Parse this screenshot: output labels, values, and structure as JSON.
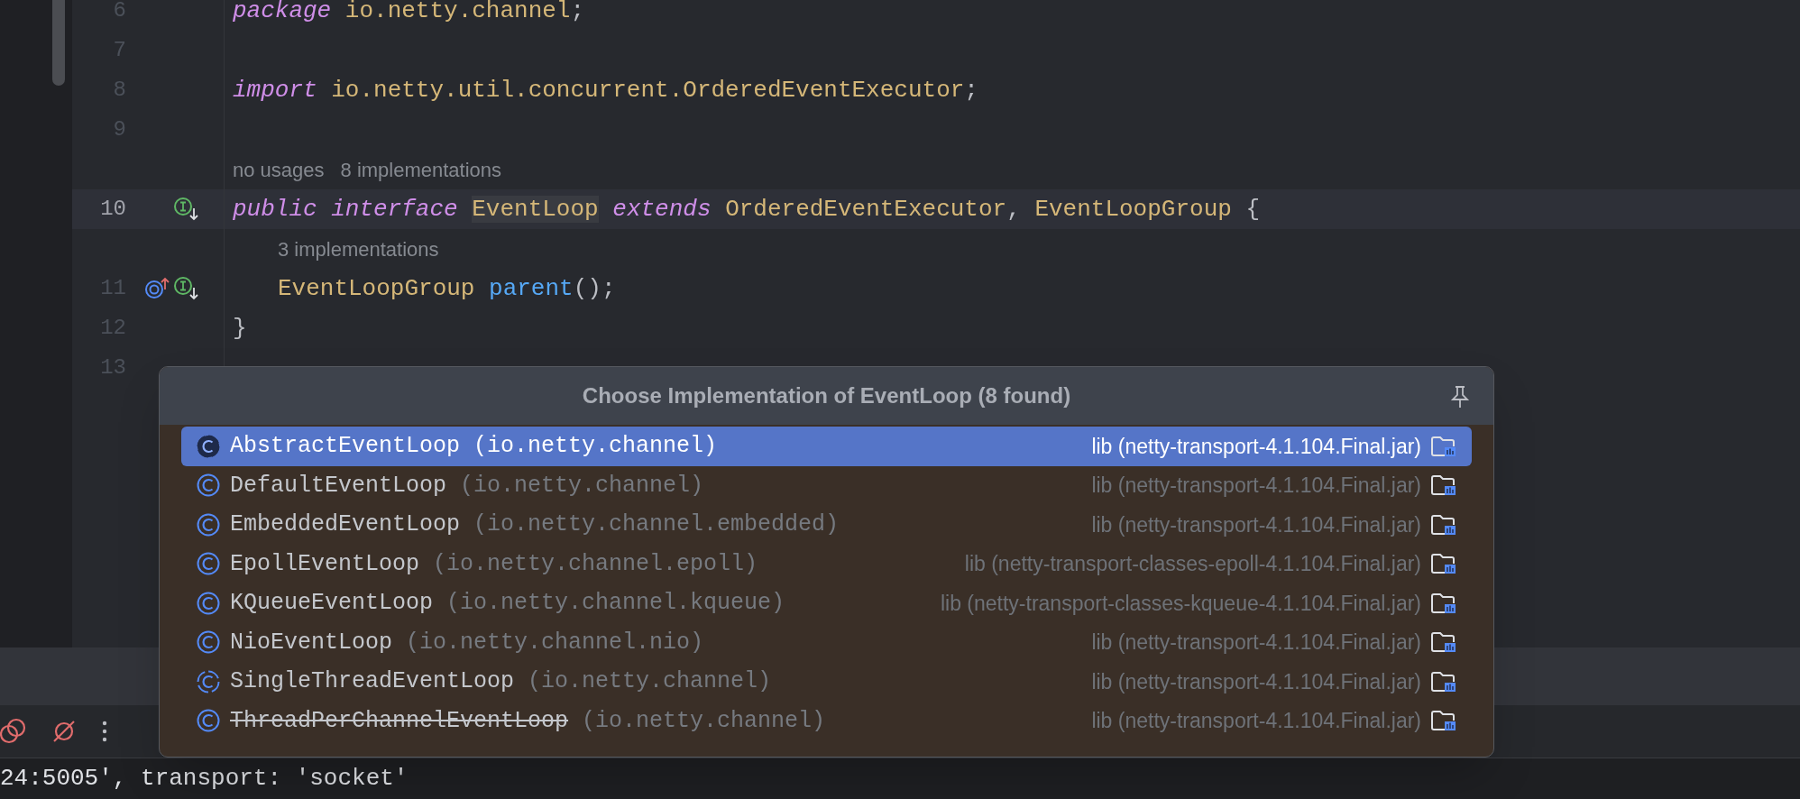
{
  "editor": {
    "lines": [
      {
        "kind": "code",
        "number": "6",
        "current": false,
        "tokens": [
          {
            "text": "package ",
            "kind": "keyword"
          },
          {
            "text": "io.netty.channel",
            "kind": "type"
          },
          {
            "text": ";",
            "kind": "plain"
          }
        ]
      },
      {
        "kind": "code",
        "number": "7",
        "current": false
      },
      {
        "kind": "code",
        "number": "8",
        "current": false,
        "tokens": [
          {
            "text": "import ",
            "kind": "keyword"
          },
          {
            "text": "io.netty.util.concurrent.OrderedEventExecutor",
            "kind": "type"
          },
          {
            "text": ";",
            "kind": "plain"
          }
        ]
      },
      {
        "kind": "code",
        "number": "9",
        "current": false
      },
      {
        "kind": "hint",
        "indented": false,
        "hints": [
          "no usages",
          "8 implementations"
        ]
      },
      {
        "kind": "code",
        "number": "10",
        "current": true,
        "gutter_icons": [
          {
            "kind": "implemented"
          }
        ],
        "tokens": [
          {
            "text": "public ",
            "kind": "keyword"
          },
          {
            "text": "interface ",
            "kind": "keyword"
          },
          {
            "text": "EventLoop",
            "kind": "type",
            "highlighted": true
          },
          {
            "text": " extends ",
            "kind": "keyword"
          },
          {
            "text": "OrderedEventExecutor",
            "kind": "type"
          },
          {
            "text": ", ",
            "kind": "plain"
          },
          {
            "text": "EventLoopGroup",
            "kind": "type"
          },
          {
            "text": " {",
            "kind": "plain"
          }
        ]
      },
      {
        "kind": "hint",
        "indented": true,
        "hints": [
          "3 implementations"
        ]
      },
      {
        "kind": "code",
        "number": "11",
        "current": false,
        "indented": true,
        "gutter_icons": [
          {
            "kind": "overrides"
          },
          {
            "kind": "implemented"
          }
        ],
        "tokens": [
          {
            "text": "EventLoopGroup ",
            "kind": "type"
          },
          {
            "text": "parent",
            "kind": "method"
          },
          {
            "text": "();",
            "kind": "plain"
          }
        ]
      },
      {
        "kind": "code",
        "number": "12",
        "current": false,
        "tokens": [
          {
            "text": "}",
            "kind": "plain"
          }
        ]
      },
      {
        "kind": "code",
        "number": "13",
        "current": false
      }
    ]
  },
  "popup": {
    "title": "Choose Implementation of EventLoop (8 found)",
    "rows": [
      {
        "kind": "abstract_class",
        "name": "AbstractEventLoop",
        "package": "(io.netty.channel)",
        "library": "lib (netty-transport-4.1.104.Final.jar)",
        "selected": true,
        "deprecated": false
      },
      {
        "kind": "class",
        "name": "DefaultEventLoop",
        "package": "(io.netty.channel)",
        "library": "lib (netty-transport-4.1.104.Final.jar)",
        "selected": false,
        "deprecated": false
      },
      {
        "kind": "class",
        "name": "EmbeddedEventLoop",
        "package": "(io.netty.channel.embedded)",
        "library": "lib (netty-transport-4.1.104.Final.jar)",
        "selected": false,
        "deprecated": false
      },
      {
        "kind": "class",
        "name": "EpollEventLoop",
        "package": "(io.netty.channel.epoll)",
        "library": "lib (netty-transport-classes-epoll-4.1.104.Final.jar)",
        "selected": false,
        "deprecated": false
      },
      {
        "kind": "class",
        "name": "KQueueEventLoop",
        "package": "(io.netty.channel.kqueue)",
        "library": "lib (netty-transport-classes-kqueue-4.1.104.Final.jar)",
        "selected": false,
        "deprecated": false
      },
      {
        "kind": "class",
        "name": "NioEventLoop",
        "package": "(io.netty.channel.nio)",
        "library": "lib (netty-transport-4.1.104.Final.jar)",
        "selected": false,
        "deprecated": false
      },
      {
        "kind": "abstract_class",
        "name": "SingleThreadEventLoop",
        "package": "(io.netty.channel)",
        "library": "lib (netty-transport-4.1.104.Final.jar)",
        "selected": false,
        "deprecated": false
      },
      {
        "kind": "class",
        "name": "ThreadPerChannelEventLoop",
        "package": "(io.netty.channel)",
        "library": "lib (netty-transport-4.1.104.Final.jar)",
        "selected": false,
        "deprecated": true
      }
    ]
  },
  "console": {
    "text": "24:5005', transport: 'socket'"
  }
}
